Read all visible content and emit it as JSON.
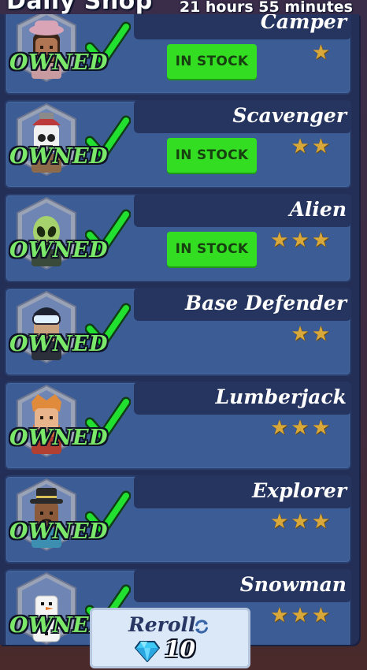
{
  "header": {
    "title": "Daily Shop",
    "timer": "21 hours 55 minutes"
  },
  "items": [
    {
      "name": "Camper",
      "stars": 1,
      "owned_label": "OWNED",
      "in_stock": true,
      "stock_label": "IN STOCK",
      "portrait": "camper-icon"
    },
    {
      "name": "Scavenger",
      "stars": 2,
      "owned_label": "OWNED",
      "in_stock": true,
      "stock_label": "IN STOCK",
      "portrait": "scavenger-icon"
    },
    {
      "name": "Alien",
      "stars": 3,
      "owned_label": "OWNED",
      "in_stock": true,
      "stock_label": "IN STOCK",
      "portrait": "alien-icon"
    },
    {
      "name": "Base Defender",
      "stars": 2,
      "owned_label": "OWNED",
      "in_stock": false,
      "stock_label": "",
      "portrait": "base-defender-icon"
    },
    {
      "name": "Lumberjack",
      "stars": 3,
      "owned_label": "OWNED",
      "in_stock": false,
      "stock_label": "",
      "portrait": "lumberjack-icon"
    },
    {
      "name": "Explorer",
      "stars": 3,
      "owned_label": "OWNED",
      "in_stock": false,
      "stock_label": "",
      "portrait": "explorer-icon"
    },
    {
      "name": "Snowman",
      "stars": 3,
      "owned_label": "OWNED",
      "in_stock": false,
      "stock_label": "",
      "portrait": "snowman-icon"
    }
  ],
  "reroll": {
    "label": "Reroll",
    "cost": "10",
    "currency_icon": "diamond-icon"
  },
  "colors": {
    "card": "#3c5c96",
    "stock_green": "#33dd22",
    "owned_green": "#7be86a",
    "check_green": "#22e030",
    "star_gold": "#d8a93a"
  }
}
